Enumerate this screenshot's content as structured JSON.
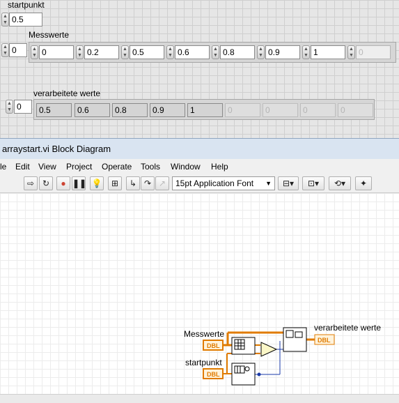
{
  "front_panel": {
    "startpunkt": {
      "label": "startpunkt",
      "value": "0.5"
    },
    "messwerte": {
      "label": "Messwerte",
      "index": "0",
      "elements": [
        "0",
        "0.2",
        "0.5",
        "0.6",
        "0.8",
        "0.9",
        "1",
        "0"
      ]
    },
    "verarbeitete": {
      "label": "verarbeitete werte",
      "index": "0",
      "elements": [
        "0.5",
        "0.6",
        "0.8",
        "0.9",
        "1",
        "0",
        "0",
        "0",
        "0"
      ]
    }
  },
  "window": {
    "title": "arraystart.vi Block Diagram"
  },
  "menu": [
    "le",
    "Edit",
    "View",
    "Project",
    "Operate",
    "Tools",
    "Window",
    "Help"
  ],
  "toolbar": {
    "font": "15pt Application Font"
  },
  "diagram": {
    "messwerte_label": "Messwerte",
    "startpunkt_label": "startpunkt",
    "output_label": "verarbeitete werte",
    "dbl": "DBL",
    "wire_orange": "#e07b00",
    "wire_blue": "#1a3aa8"
  }
}
